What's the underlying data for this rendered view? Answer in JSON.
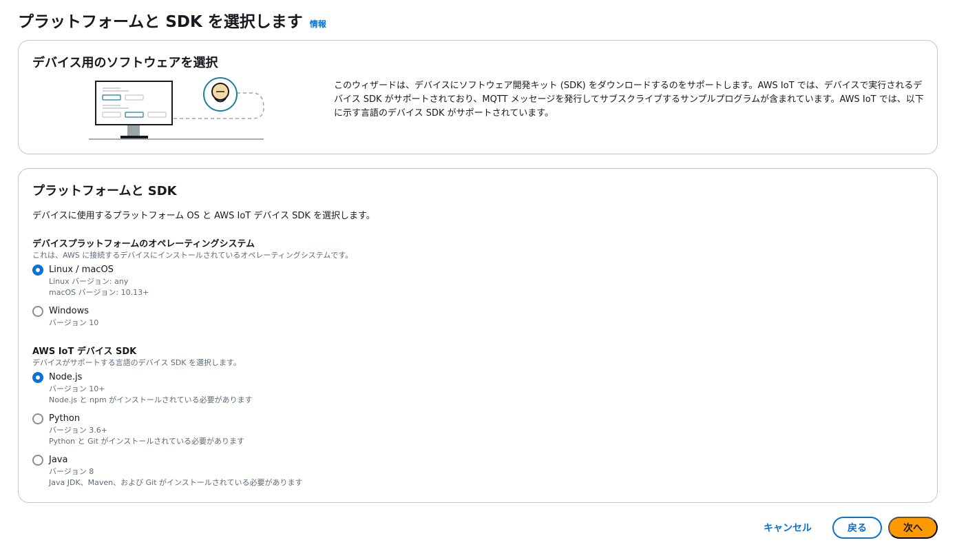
{
  "header": {
    "title": "プラットフォームと SDK を選択します",
    "info_link": "情報"
  },
  "software_card": {
    "title": "デバイス用のソフトウェアを選択",
    "description": "このウィザードは、デバイスにソフトウェア開発キット (SDK) をダウンロードするのをサポートします。AWS IoT では、デバイスで実行されるデバイス SDK がサポートされており、MQTT メッセージを発行してサブスクライブするサンプルプログラムが含まれています。AWS IoT では、以下に示す言語のデバイス SDK がサポートされています。"
  },
  "platform_card": {
    "title": "プラットフォームと SDK",
    "description": "デバイスに使用するプラットフォーム OS と AWS IoT デバイス SDK を選択します。",
    "os_section": {
      "label": "デバイスプラットフォームのオペレーティングシステム",
      "hint": "これは、AWS に接続するデバイスにインストールされているオペレーティングシステムです。",
      "options": [
        {
          "label": "Linux / macOS",
          "sub1": "Linux バージョン: any",
          "sub2": "macOS バージョン: 10.13+",
          "checked": true
        },
        {
          "label": "Windows",
          "sub1": "バージョン 10",
          "sub2": "",
          "checked": false
        }
      ]
    },
    "sdk_section": {
      "label": "AWS IoT デバイス SDK",
      "hint": "デバイスがサポートする言語のデバイス SDK を選択します。",
      "options": [
        {
          "label": "Node.js",
          "sub1": "バージョン 10+",
          "sub2": "Node.js と npm がインストールされている必要があります",
          "checked": true
        },
        {
          "label": "Python",
          "sub1": "バージョン 3.6+",
          "sub2": "Python と Git がインストールされている必要があります",
          "checked": false
        },
        {
          "label": "Java",
          "sub1": "バージョン 8",
          "sub2": "Java JDK、Maven、および Git がインストールされている必要があります",
          "checked": false
        }
      ]
    }
  },
  "footer": {
    "cancel": "キャンセル",
    "back": "戻る",
    "next": "次へ"
  },
  "colors": {
    "accent": "#0972d3",
    "primary_button": "#ff9900",
    "illustration_teal": "#1b7f9e"
  }
}
